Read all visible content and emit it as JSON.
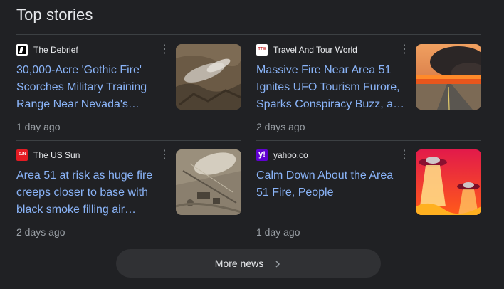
{
  "section_title": "Top stories",
  "stories": [
    {
      "source": "The Debrief",
      "headline": "30,000-Acre 'Gothic Fire' Scorches Military Training Range Near Nevada's…",
      "time": "1 day ago",
      "favicon_bg": "#ffffff",
      "thumb_desc": "aerial-smoke-fire"
    },
    {
      "source": "Travel And Tour World",
      "favicon_text": "TTW",
      "headline": "Massive Fire Near Area 51 Ignites UFO Tourism Furore, Sparks Conspiracy Buzz, a…",
      "time": "2 days ago",
      "favicon_bg": "#ffffff",
      "thumb_desc": "highway-wildfire"
    },
    {
      "source": "The US Sun",
      "favicon_text": "SUN",
      "headline": "Area 51 at risk as huge fire creeps closer to base with black smoke filling air…",
      "time": "2 days ago",
      "favicon_bg": "#e31b23",
      "thumb_desc": "satellite-base"
    },
    {
      "source": "yahoo.co",
      "favicon_text": "y!",
      "headline": "Calm Down About the Area 51 Fire, People",
      "time": "1 day ago",
      "favicon_bg": "#6001d2",
      "thumb_desc": "ufo-fire-art"
    }
  ],
  "more_news_label": "More news",
  "colors": {
    "background": "#202124",
    "link": "#8ab4f8",
    "muted": "#9aa0a6",
    "divider": "#3c4043",
    "button": "#303134"
  }
}
